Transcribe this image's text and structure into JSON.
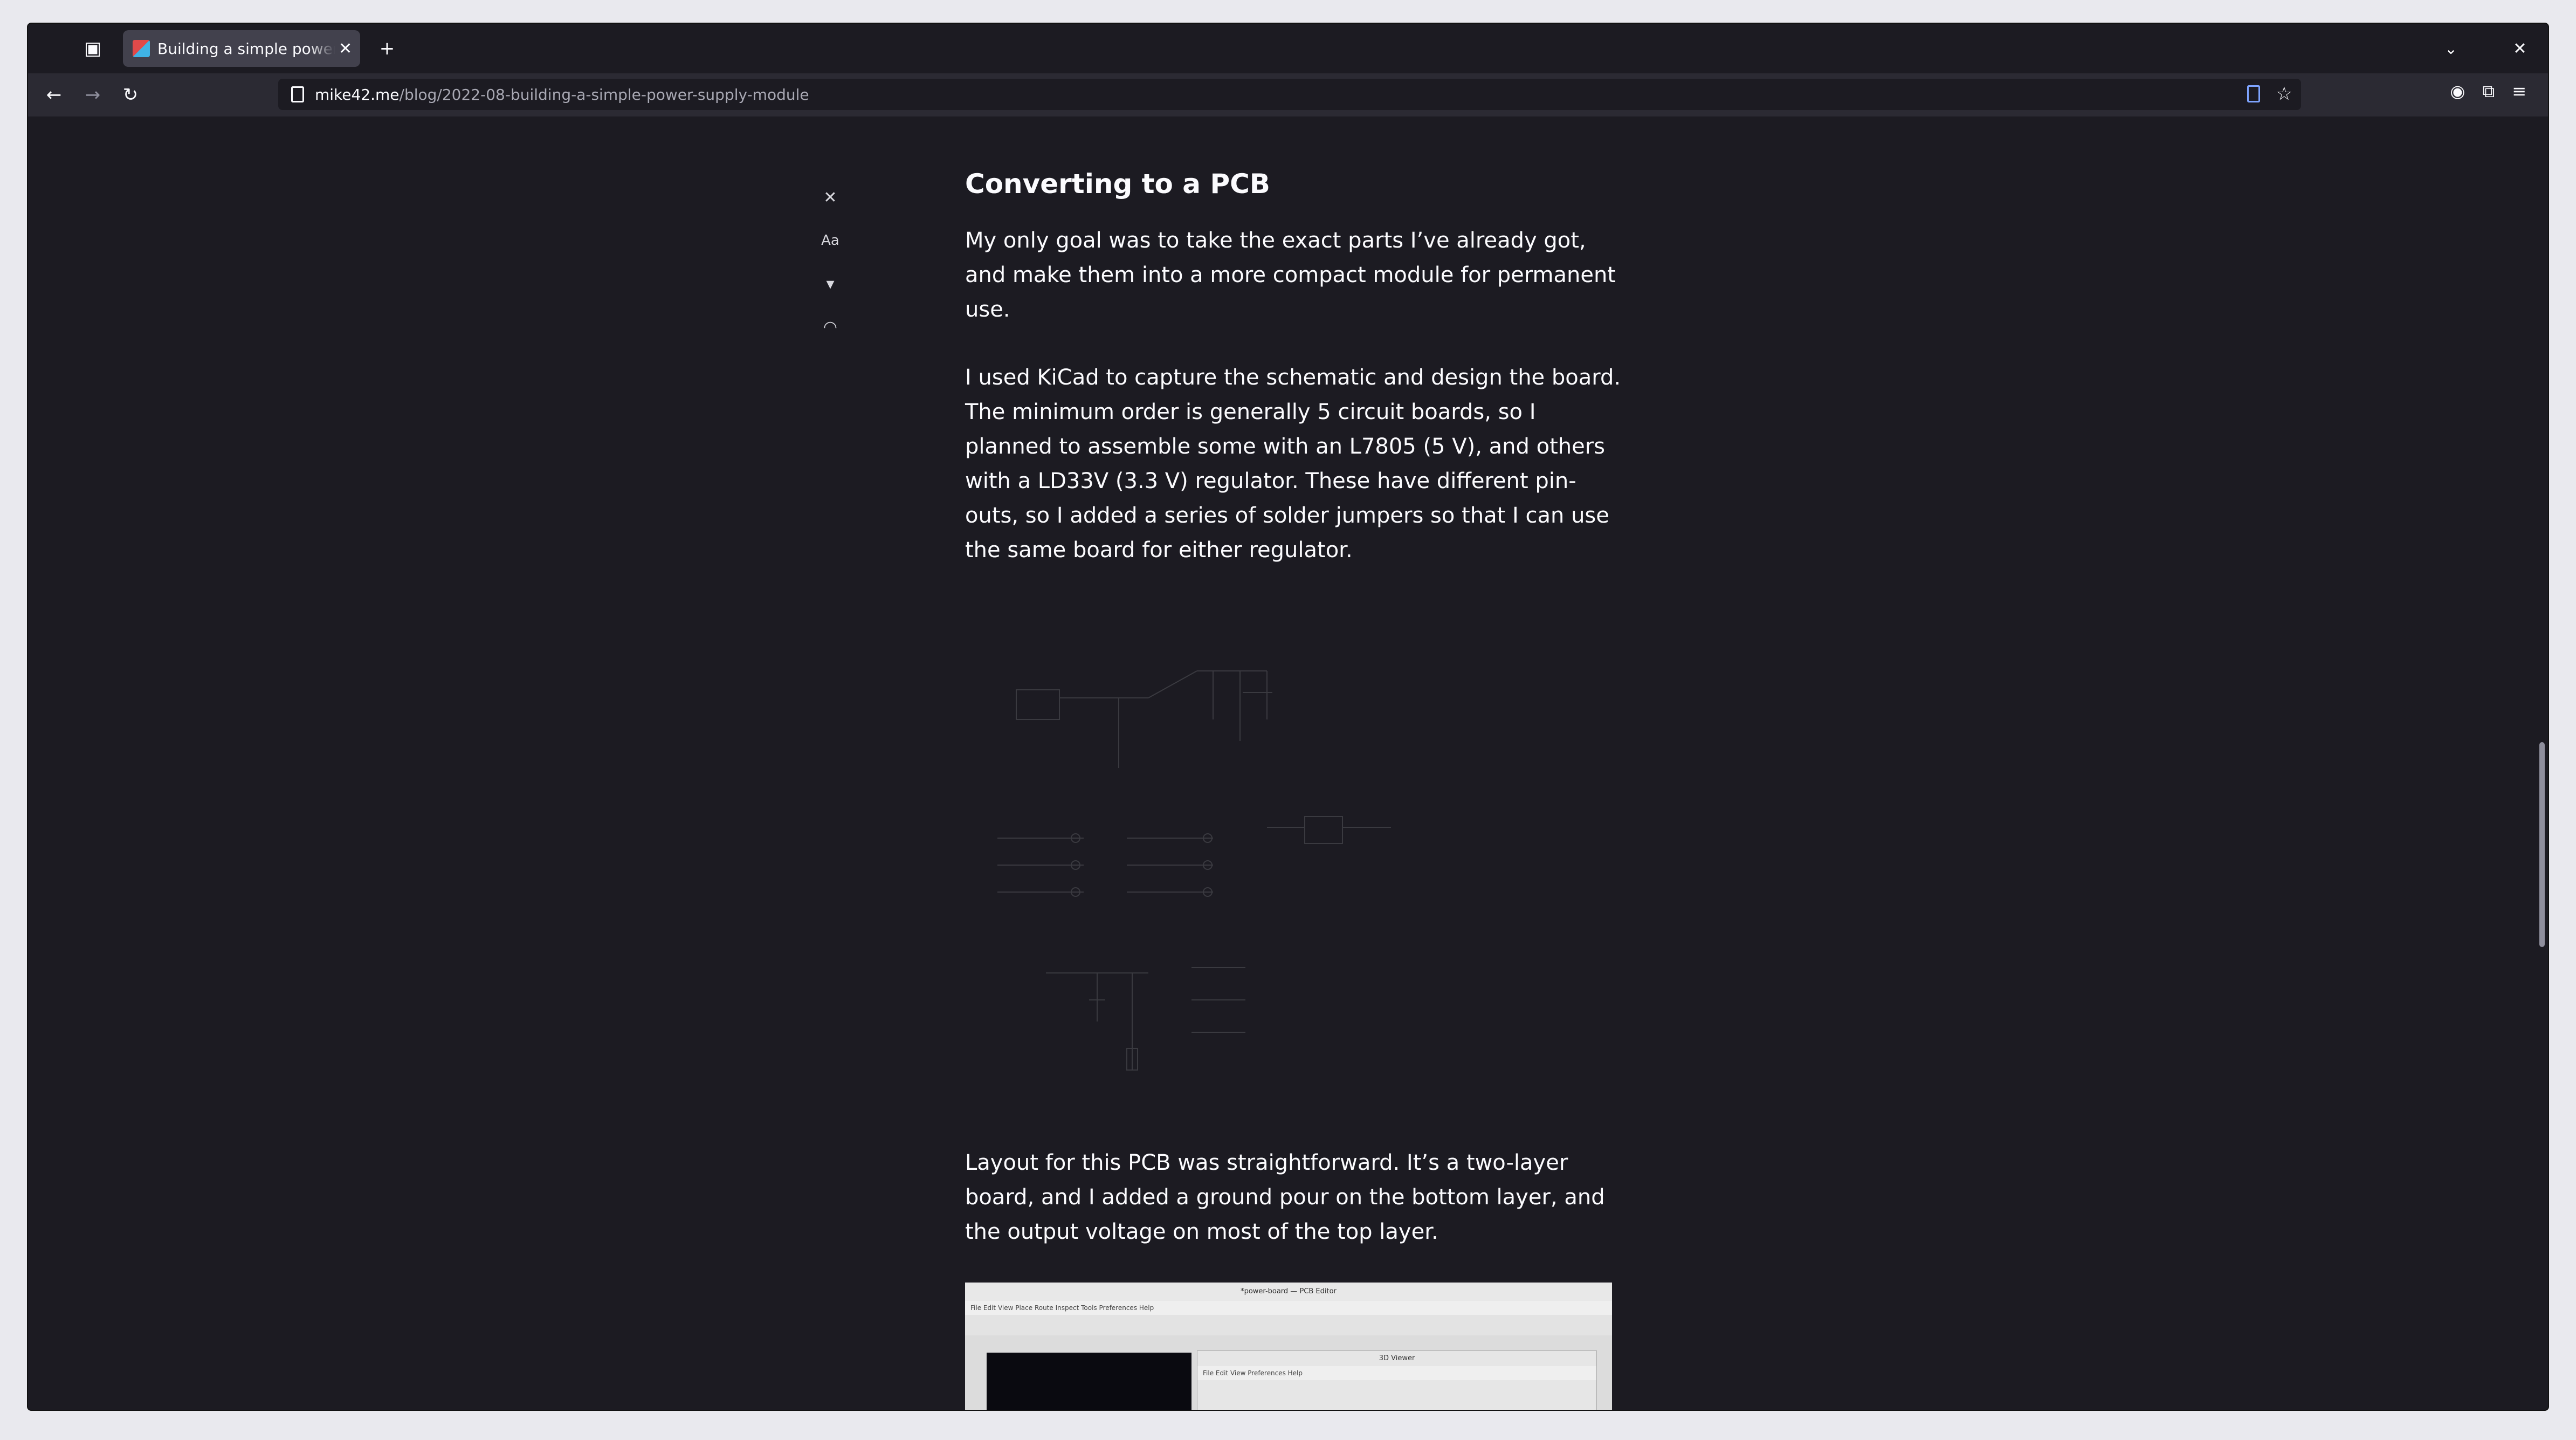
{
  "browser": {
    "tab_title": "Building a simple power supply module",
    "url_host": "mike42.me",
    "url_path": "/blog/2022-08-building-a-simple-power-supply-module"
  },
  "reader_controls": {
    "close": "✕",
    "type": "Aa"
  },
  "article": {
    "heading": "Converting to a PCB",
    "p1": "My only goal was to take the exact parts I’ve already got, and make them into a more compact module for permanent use.",
    "p2": "I used KiCad to capture the schematic and design the board. The minimum order is generally 5 circuit boards, so I planned to assemble some with an L7805 (5 V), and others with a LD33V (3.3 V) regulator. These have different pin-outs, so I added a series of solder jumpers so that I can use the same board for either regulator.",
    "p3": "Layout for this PCB was straightforward. It’s a two-layer board, and I added a ground pour on the bottom layer, and the output voltage on most of the top layer."
  },
  "pcb_screenshot": {
    "title": "*power-board — PCB Editor",
    "menu": "File  Edit  View  Place  Route  Inspect  Tools  Preferences  Help",
    "viewer_title": "3D Viewer",
    "viewer_menu": "File  Edit  View  Preferences  Help"
  },
  "colors": {
    "background": "#1c1b22",
    "toolbar": "#2b2a33",
    "accent": "#7ea4ff"
  }
}
